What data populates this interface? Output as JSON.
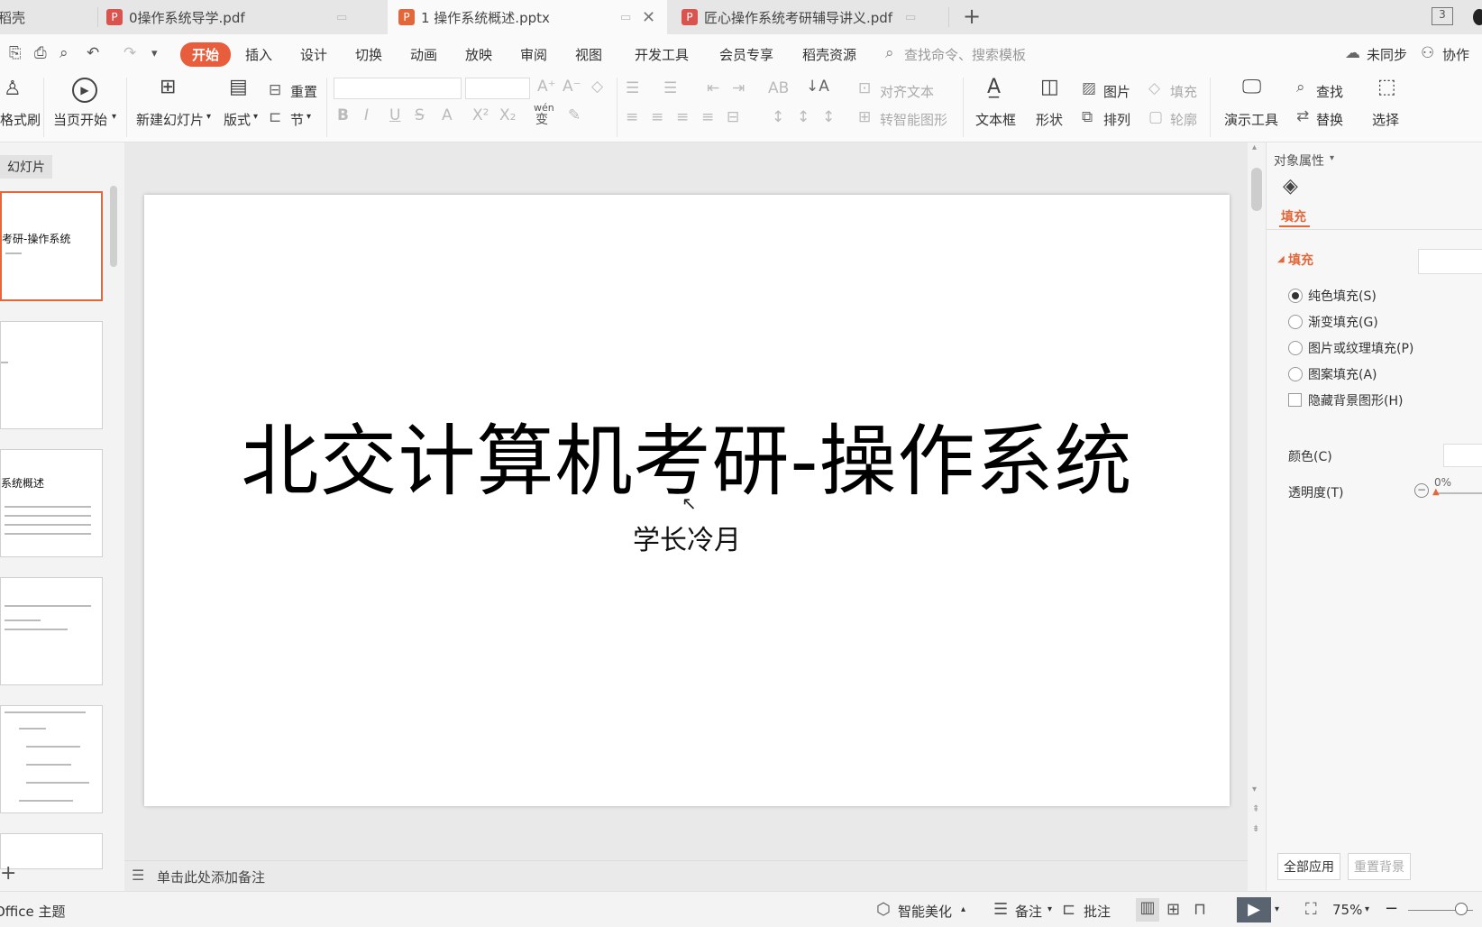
{
  "tabs": [
    {
      "label": "稻壳",
      "icon": "none"
    },
    {
      "label": "0操作系统导学.pdf",
      "icon": "pdf-icon"
    },
    {
      "label": "1 操作系统概述.pptx",
      "icon": "ppt-icon",
      "active": true
    },
    {
      "label": "匠心操作系统考研辅导讲义.pdf",
      "icon": "pdf-icon"
    }
  ],
  "tabbar": {
    "new_tab": "+",
    "window_count": "3"
  },
  "menu": {
    "items": [
      "开始",
      "插入",
      "设计",
      "切换",
      "动画",
      "放映",
      "审阅",
      "视图",
      "开发工具",
      "会员专享",
      "稻壳资源"
    ],
    "search_placeholder": "查找命令、搜索模板",
    "sync": "未同步",
    "collab": "协作"
  },
  "ribbon": {
    "format_painter": "格式刷",
    "play_current": "当页开始",
    "new_slide": "新建幻灯片",
    "layout": "版式",
    "reset": "重置",
    "section": "节",
    "align_text": "对齐文本",
    "convert_smartart": "转智能图形",
    "textbox": "文本框",
    "shape": "形状",
    "picture": "图片",
    "fill": "填充",
    "arrange": "排列",
    "outline": "轮廓",
    "present_tools": "演示工具",
    "find": "查找",
    "replace": "替换",
    "select": "选择",
    "wen_label": "wén",
    "wen_char": "变"
  },
  "thumbs": {
    "header": "幻灯片",
    "slide1_title": "考研-操作系统",
    "slide3_title": "系统概述"
  },
  "slide": {
    "title": "北交计算机考研-操作系统",
    "subtitle": "学长冷月"
  },
  "notes": {
    "placeholder": "单击此处添加备注"
  },
  "props": {
    "header": "对象属性",
    "tab_fill": "填充",
    "section_fill": "填充",
    "options": [
      "纯色填充(S)",
      "渐变填充(G)",
      "图片或纹理填充(P)",
      "图案填充(A)"
    ],
    "hide_bg": "隐藏背景图形(H)",
    "color": "颜色(C)",
    "transparency": "透明度(T)",
    "transparency_value": "0%",
    "apply_all": "全部应用",
    "reset_bg": "重置背景"
  },
  "status": {
    "theme": "Office 主题",
    "beautify": "智能美化",
    "notes": "备注",
    "comments": "批注",
    "zoom": "75%"
  }
}
